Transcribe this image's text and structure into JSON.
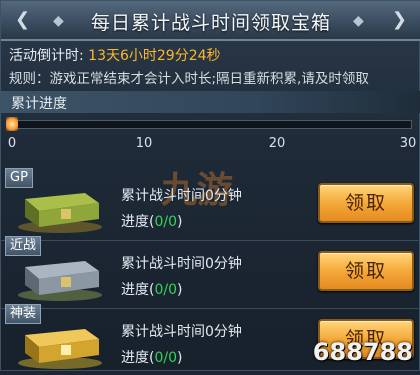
{
  "header": {
    "title": "每日累计战斗时间领取宝箱"
  },
  "countdown": {
    "label": "活动倒计时:",
    "value": "13天6小时29分24秒"
  },
  "rules": "规则：游戏正常结束才会计入时长;隔日重新积累,请及时领取",
  "progress": {
    "label": "累计进度",
    "fraction": 0.0,
    "ticks": [
      "0",
      "10",
      "20",
      "30"
    ]
  },
  "rewards": [
    {
      "tag": "GP",
      "time_text": "累计战斗时间0分钟",
      "progress_label": "进度(",
      "progress_count": "0/0",
      "progress_close": ")",
      "button": "领取",
      "chest_color": "#8fa63a"
    },
    {
      "tag": "近战",
      "time_text": "累计战斗时间0分钟",
      "progress_label": "进度(",
      "progress_count": "0/0",
      "progress_close": ")",
      "button": "领取",
      "chest_color": "#8b97a3"
    },
    {
      "tag": "神装",
      "time_text": "累计战斗时间0分钟",
      "progress_label": "进度(",
      "progress_count": "0/0",
      "progress_close": ")",
      "button": "领取",
      "chest_color": "#d4a52e"
    }
  ],
  "watermark": "九游",
  "site_label": "688788"
}
